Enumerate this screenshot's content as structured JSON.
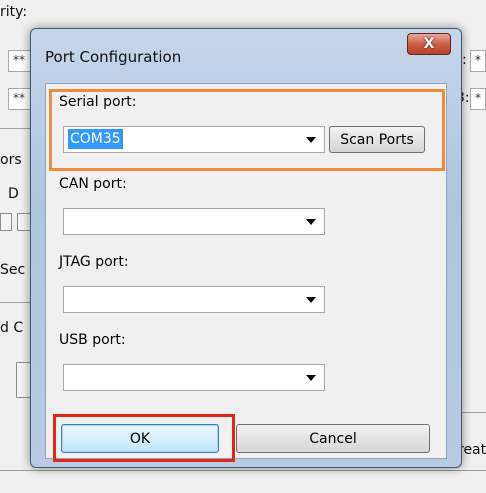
{
  "background": {
    "label_top": "rity:",
    "field_1": "**",
    "field_2": "**",
    "field_colon_1": ":",
    "field_colon_2": "3:",
    "right_field_1": "*",
    "right_field_2": "*",
    "label_ors": "ors",
    "label_d": "D",
    "label_sec": "Sec",
    "label_dc": "d C",
    "label_reat": "reat"
  },
  "dialog": {
    "title": "Port Configuration",
    "close_label": "X",
    "serial_port": {
      "label": "Serial port:",
      "value": "COM35",
      "scan_label": "Scan Ports"
    },
    "can_port": {
      "label": "CAN port:",
      "value": ""
    },
    "jtag_port": {
      "label": "JTAG port:",
      "value": ""
    },
    "usb_port": {
      "label": "USB port:",
      "value": ""
    },
    "ok_label": "OK",
    "cancel_label": "Cancel"
  },
  "colors": {
    "highlight_orange": "#f08a3c",
    "highlight_red": "#e0281a",
    "selection": "#3399ff"
  }
}
